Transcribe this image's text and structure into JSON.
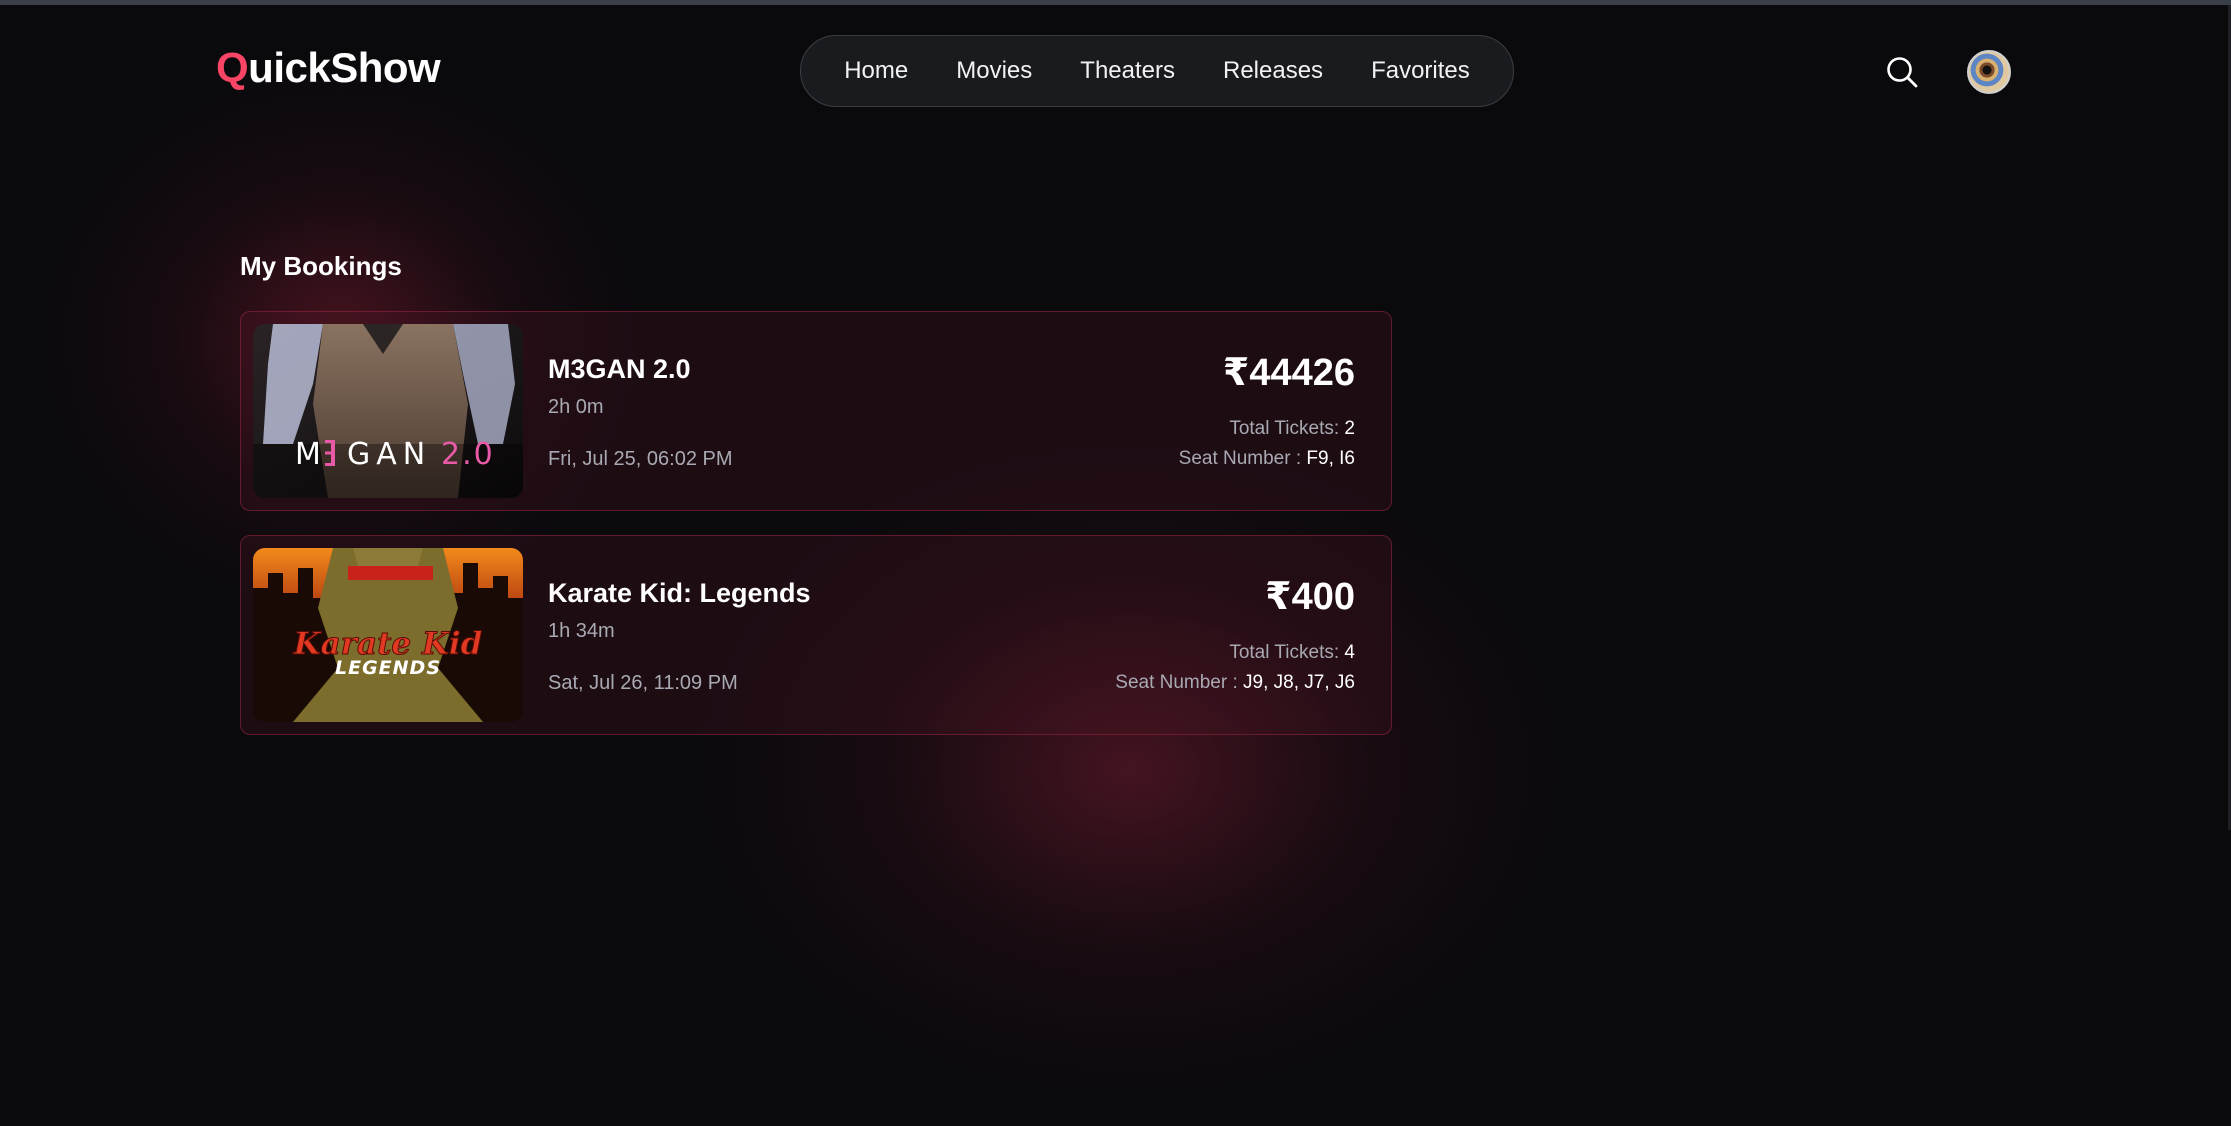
{
  "header": {
    "logo_initial": "Q",
    "logo_rest": "uickShow",
    "nav": [
      "Home",
      "Movies",
      "Theaters",
      "Releases",
      "Favorites"
    ],
    "search_icon": "search-icon",
    "avatar_icon": "user-avatar"
  },
  "page": {
    "title": "My Bookings"
  },
  "bookings": [
    {
      "title": "M3GAN 2.0",
      "runtime": "2h 0m",
      "showtime": "Fri, Jul 25, 06:02 PM",
      "price": "₹44426",
      "tickets_label": "Total Tickets:",
      "tickets": "2",
      "seats_label": "Seat Number :",
      "seats": "F9, I6",
      "poster_text_1": "M",
      "poster_text_2": "GAN",
      "poster_text_3": "2.0"
    },
    {
      "title": "Karate Kid: Legends",
      "runtime": "1h 34m",
      "showtime": "Sat, Jul 26, 11:09 PM",
      "price": "₹400",
      "tickets_label": "Total Tickets:",
      "tickets": "4",
      "seats_label": "Seat Number :",
      "seats": "J9, J8, J7, J6",
      "poster_text_1": "Karate Kid",
      "poster_text_2": "LEGENDS"
    }
  ],
  "colors": {
    "accent": "#f84565",
    "background": "#0a0a0d",
    "card_border": "#9b2841"
  }
}
